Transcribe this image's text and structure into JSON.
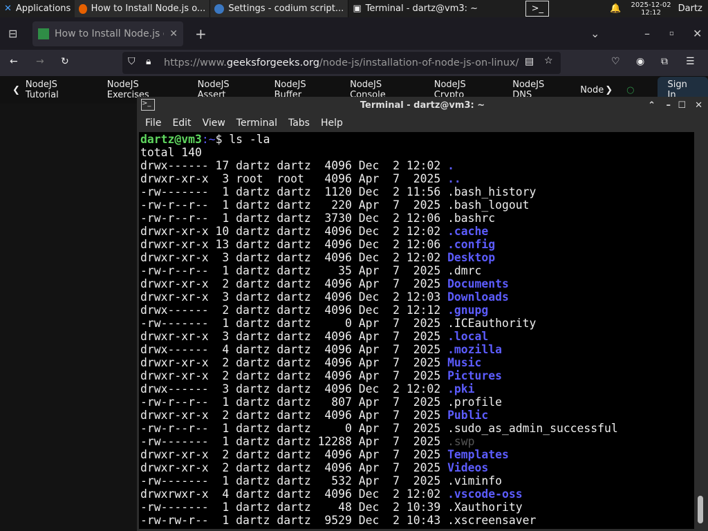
{
  "panel": {
    "apps": "Applications",
    "tasks": [
      "How to Install Node.js o...",
      "Settings - codium script...",
      "Terminal - dartz@vm3: ~"
    ],
    "date": "2025-12-02",
    "time": "12:12",
    "user": "Dartz"
  },
  "browser": {
    "tab_title": "How to Install Node.js on",
    "url_prefix": "https://www.",
    "url_domain": "geeksforgeeks.org",
    "url_path": "/node-js/installation-of-node-js-on-linux/",
    "bookmarks": [
      "NodeJS Tutorial",
      "NodeJS Exercises",
      "NodeJS Assert",
      "NodeJS Buffer",
      "NodeJS Console",
      "NodeJS Crypto",
      "NodeJS DNS",
      "Node"
    ],
    "sign_in": "Sign In"
  },
  "terminal": {
    "title": "Terminal - dartz@vm3: ~",
    "menu": [
      "File",
      "Edit",
      "View",
      "Terminal",
      "Tabs",
      "Help"
    ],
    "prompt_user": "dartz@vm3",
    "prompt_path": ":~",
    "prompt_symbol": "$ ",
    "command": "ls -la",
    "total": "total 140",
    "entries": [
      {
        "meta": "drwx------ 17 dartz dartz  4096 Dec  2 12:02 ",
        "name": ".",
        "type": "dir"
      },
      {
        "meta": "drwxr-xr-x  3 root  root   4096 Apr  7  2025 ",
        "name": "..",
        "type": "dir"
      },
      {
        "meta": "-rw-------  1 dartz dartz  1120 Dec  2 11:56 ",
        "name": ".bash_history",
        "type": "file"
      },
      {
        "meta": "-rw-r--r--  1 dartz dartz   220 Apr  7  2025 ",
        "name": ".bash_logout",
        "type": "file"
      },
      {
        "meta": "-rw-r--r--  1 dartz dartz  3730 Dec  2 12:06 ",
        "name": ".bashrc",
        "type": "file"
      },
      {
        "meta": "drwxr-xr-x 10 dartz dartz  4096 Dec  2 12:02 ",
        "name": ".cache",
        "type": "dir"
      },
      {
        "meta": "drwxr-xr-x 13 dartz dartz  4096 Dec  2 12:06 ",
        "name": ".config",
        "type": "dir"
      },
      {
        "meta": "drwxr-xr-x  3 dartz dartz  4096 Dec  2 12:02 ",
        "name": "Desktop",
        "type": "dir"
      },
      {
        "meta": "-rw-r--r--  1 dartz dartz    35 Apr  7  2025 ",
        "name": ".dmrc",
        "type": "file"
      },
      {
        "meta": "drwxr-xr-x  2 dartz dartz  4096 Apr  7  2025 ",
        "name": "Documents",
        "type": "dir"
      },
      {
        "meta": "drwxr-xr-x  3 dartz dartz  4096 Dec  2 12:03 ",
        "name": "Downloads",
        "type": "dir"
      },
      {
        "meta": "drwx------  2 dartz dartz  4096 Dec  2 12:12 ",
        "name": ".gnupg",
        "type": "dir"
      },
      {
        "meta": "-rw-------  1 dartz dartz     0 Apr  7  2025 ",
        "name": ".ICEauthority",
        "type": "file"
      },
      {
        "meta": "drwxr-xr-x  3 dartz dartz  4096 Apr  7  2025 ",
        "name": ".local",
        "type": "dir"
      },
      {
        "meta": "drwx------  4 dartz dartz  4096 Apr  7  2025 ",
        "name": ".mozilla",
        "type": "dir"
      },
      {
        "meta": "drwxr-xr-x  2 dartz dartz  4096 Apr  7  2025 ",
        "name": "Music",
        "type": "dir"
      },
      {
        "meta": "drwxr-xr-x  2 dartz dartz  4096 Apr  7  2025 ",
        "name": "Pictures",
        "type": "dir"
      },
      {
        "meta": "drwx------  3 dartz dartz  4096 Dec  2 12:02 ",
        "name": ".pki",
        "type": "dir"
      },
      {
        "meta": "-rw-r--r--  1 dartz dartz   807 Apr  7  2025 ",
        "name": ".profile",
        "type": "file"
      },
      {
        "meta": "drwxr-xr-x  2 dartz dartz  4096 Apr  7  2025 ",
        "name": "Public",
        "type": "dir"
      },
      {
        "meta": "-rw-r--r--  1 dartz dartz     0 Apr  7  2025 ",
        "name": ".sudo_as_admin_successful",
        "type": "file"
      },
      {
        "meta": "-rw-------  1 dartz dartz 12288 Apr  7  2025 ",
        "name": ".swp",
        "type": "dim"
      },
      {
        "meta": "drwxr-xr-x  2 dartz dartz  4096 Apr  7  2025 ",
        "name": "Templates",
        "type": "dir"
      },
      {
        "meta": "drwxr-xr-x  2 dartz dartz  4096 Apr  7  2025 ",
        "name": "Videos",
        "type": "dir"
      },
      {
        "meta": "-rw-------  1 dartz dartz   532 Apr  7  2025 ",
        "name": ".viminfo",
        "type": "file"
      },
      {
        "meta": "drwxrwxr-x  4 dartz dartz  4096 Dec  2 12:02 ",
        "name": ".vscode-oss",
        "type": "dir"
      },
      {
        "meta": "-rw-------  1 dartz dartz    48 Dec  2 10:39 ",
        "name": ".Xauthority",
        "type": "file"
      },
      {
        "meta": "-rw-rw-r--  1 dartz dartz  9529 Dec  2 10:43 ",
        "name": ".xscreensaver",
        "type": "file"
      }
    ]
  },
  "colors": {
    "dir": "#5c5cff",
    "prompt": "#5fd75f",
    "dim": "#555555"
  }
}
